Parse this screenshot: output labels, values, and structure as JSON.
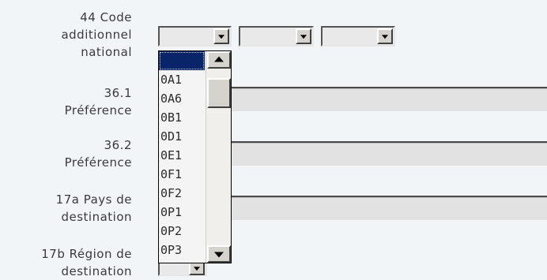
{
  "labels": {
    "code_additionnel": "44 Code\nadditionnel\nnational",
    "pref_361": "36.1\nPréférence",
    "pref_362": "36.2\nPréférence",
    "pays_dest": "17a Pays de\ndestination",
    "region_dest": "17b Région de\ndestination"
  },
  "code_selects": [
    {
      "value": ""
    },
    {
      "value": ""
    },
    {
      "value": ""
    }
  ],
  "dropdown_options": [
    "",
    "0A1",
    "0A6",
    "0B1",
    "0D1",
    "0E1",
    "0F1",
    "0F2",
    "0P1",
    "0P2",
    "0P3"
  ],
  "selected_index": 0,
  "colors": {
    "background": "#f2f5f8",
    "field": "#e2e2e2",
    "selection": "#0a246a"
  }
}
